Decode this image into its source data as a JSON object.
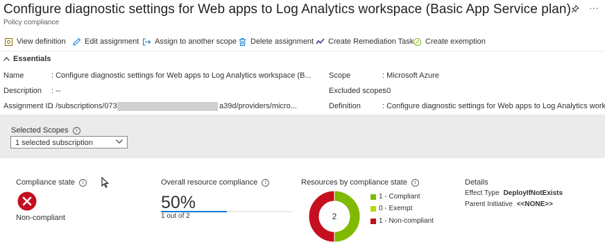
{
  "header": {
    "title": "Configure diagnostic settings for Web apps to Log Analytics workspace (Basic App Service plan)",
    "subtitle": "Policy compliance",
    "pin_icon": "pin-icon",
    "more_icon": "more-icon"
  },
  "toolbar": {
    "view_definition": "View definition",
    "edit_assignment": "Edit assignment",
    "assign_scope": "Assign to another scope",
    "delete_assignment": "Delete assignment",
    "remediation": "Create Remediation Task",
    "exemption": "Create exemption"
  },
  "essentials": {
    "toggle_label": "Essentials",
    "name_label": "Name",
    "name_value": ": Configure diagnostic settings for Web apps to Log Analytics workspace (B...",
    "description_label": "Description",
    "description_value": ": --",
    "assignment_label": "Assignment ID",
    "assignment_value_start": ": /subscriptions/073d",
    "assignment_value_end": "a39d/providers/micro...",
    "scope_label": "Scope",
    "scope_value": ": Microsoft Azure",
    "excluded_label": "Excluded scopes",
    "excluded_value": ": 0",
    "definition_label": "Definition",
    "definition_value": ": Configure diagnostic settings for Web apps to Log Analytics workspace"
  },
  "scopes": {
    "label": "Selected Scopes",
    "selected": "1 selected subscription"
  },
  "compliance_state": {
    "title": "Compliance state",
    "status": "Non-compliant",
    "status_color": "#c50f1f"
  },
  "overall": {
    "title": "Overall resource compliance",
    "percent_text": "50%",
    "percent": 50,
    "detail": "1 out of 2"
  },
  "resources": {
    "title": "Resources by compliance state",
    "total": "2",
    "legend": [
      {
        "label": "1 - Compliant",
        "count": 1,
        "color": "#7fba00"
      },
      {
        "label": "0 - Exempt",
        "count": 0,
        "color": "#bad80a"
      },
      {
        "label": "1 - Non-compliant",
        "count": 1,
        "color": "#c50f1f"
      }
    ]
  },
  "details": {
    "title": "Details",
    "effect_label": "Effect Type",
    "effect_value": "DeployIfNotExists",
    "parent_label": "Parent Initiative",
    "parent_value": "<<NONE>>"
  }
}
